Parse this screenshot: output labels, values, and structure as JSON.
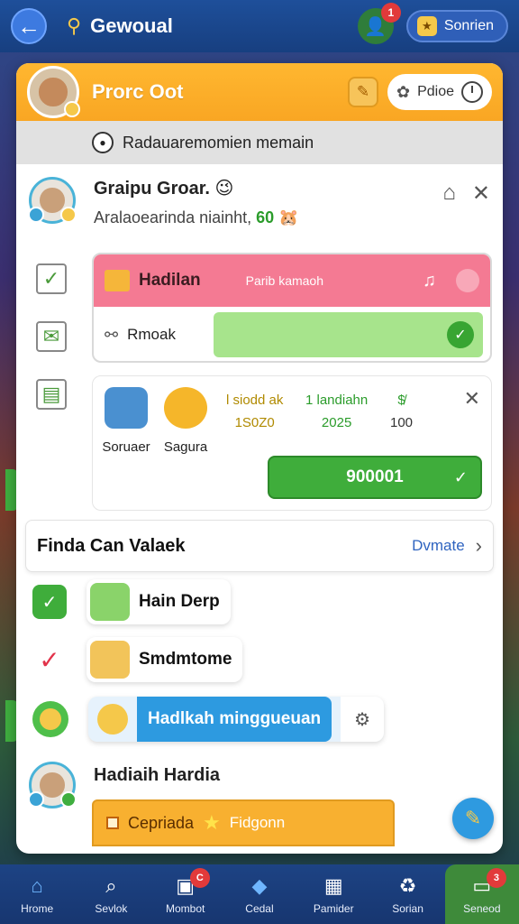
{
  "topbar": {
    "title": "Gewoual",
    "notif_count": "1",
    "pill_label": "Sonrien",
    "pill_icon": "shield-icon"
  },
  "profile": {
    "name": "Prorc Oot",
    "edit_icon": "pencil-icon",
    "pill_label": "Pdioe",
    "pill_icon": "puzzle-icon",
    "timer_icon": "clock-icon"
  },
  "ribbon": {
    "text": "Radauaremomien memain"
  },
  "group": {
    "title": "Graipu Groar.",
    "subtitle": "Aralaoearinda niainht,",
    "subtitle_value": "60",
    "home_icon": "home-icon",
    "close_icon": "close-icon"
  },
  "reward": {
    "title": "Hadilan",
    "middle": "Parib kamaoh",
    "body_label": "Rmoak"
  },
  "items": {
    "item1_label": "Soruaer",
    "item2_label": "Sagura",
    "stat1_line1": "l siodd ak",
    "stat1_line2": "1S0Z0",
    "stat2_line1": "1 landiahn",
    "stat2_line2": "2025",
    "stat3_line1": "$̸",
    "stat3_line2": "100",
    "button_label": "900001"
  },
  "find": {
    "title": "Finda Can Valaek",
    "link": "Dvmate"
  },
  "list": [
    {
      "label": "Hain Derp"
    },
    {
      "label": "Smdmtome"
    },
    {
      "label": "Hadlkah minggueuan"
    }
  ],
  "prize": {
    "title": "Hadiaih Hardia",
    "bar_label": "Cepriada",
    "bar_label2": "Fidgonn"
  },
  "nav": [
    {
      "label": "Hrome",
      "icon": "home-icon"
    },
    {
      "label": "Sevlok",
      "icon": "search-icon"
    },
    {
      "label": "Mombot",
      "icon": "bot-icon",
      "badge": "C"
    },
    {
      "label": "Cedal",
      "icon": "shield-icon"
    },
    {
      "label": "Pamider",
      "icon": "card-icon"
    },
    {
      "label": "Sorian",
      "icon": "recycle-icon"
    },
    {
      "label": "Seneod",
      "icon": "wallet-icon",
      "badge": "3"
    }
  ],
  "colors": {
    "topbar": "#1e4f9a",
    "header_orange": "#f9a623",
    "reward_pink": "#f47a93",
    "green": "#3fad3b",
    "blue": "#2d9ae0"
  }
}
